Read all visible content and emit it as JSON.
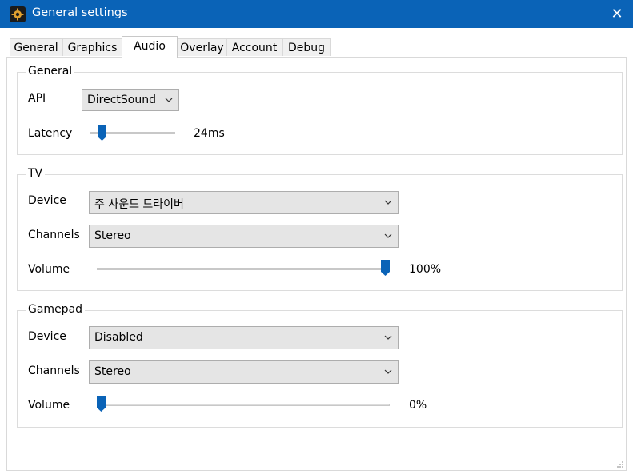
{
  "window": {
    "title": "General settings",
    "close_label": "✕",
    "accent_color": "#0a63b7",
    "icon": "gear-icon"
  },
  "tabs": [
    {
      "label": "General",
      "active": false
    },
    {
      "label": "Graphics",
      "active": false
    },
    {
      "label": "Audio",
      "active": true
    },
    {
      "label": "Overlay",
      "active": false
    },
    {
      "label": "Account",
      "active": false
    },
    {
      "label": "Debug",
      "active": false
    }
  ],
  "general_group": {
    "title": "General",
    "api_label": "API",
    "api_value": "DirectSound",
    "latency_label": "Latency",
    "latency_value": "24ms",
    "latency_fraction": 0.1
  },
  "tv_group": {
    "title": "TV",
    "device_label": "Device",
    "device_value": "주 사운드 드라이버",
    "channels_label": "Channels",
    "channels_value": "Stereo",
    "volume_label": "Volume",
    "volume_value": "100%",
    "volume_fraction": 1.0
  },
  "gamepad_group": {
    "title": "Gamepad",
    "device_label": "Device",
    "device_value": "Disabled",
    "channels_label": "Channels",
    "channels_value": "Stereo",
    "volume_label": "Volume",
    "volume_value": "0%",
    "volume_fraction": 0.0
  }
}
